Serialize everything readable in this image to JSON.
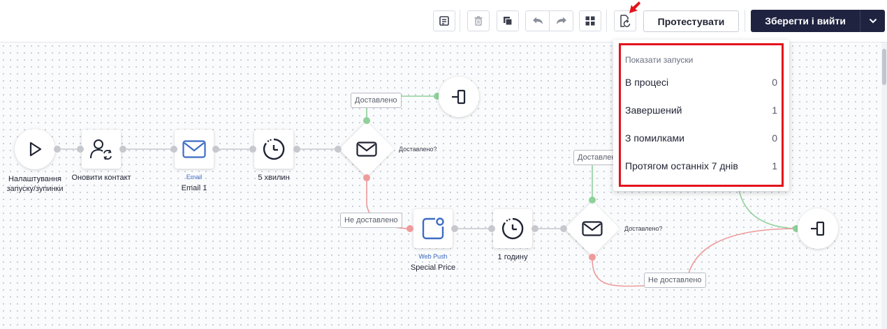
{
  "toolbar": {
    "icons": [
      "note-icon",
      "trash-icon",
      "duplicate-icon",
      "undo-icon",
      "redo-icon",
      "layout-grid-icon",
      "runs-history-icon"
    ],
    "test_label": "Протестувати",
    "save_label": "Зберегти і вийти"
  },
  "colors": {
    "accent_dark": "#1f2340",
    "email_blue": "#3e6bc4",
    "success_green": "#8fd19a",
    "fail_red": "#ee9b9b",
    "highlight_red": "#e3121a"
  },
  "nodes": {
    "start": {
      "label": "Налаштування\nзапуску/зупинки"
    },
    "update_contact": {
      "label": "Оновити контакт"
    },
    "email": {
      "type": "Email",
      "label": "Email 1"
    },
    "wait1": {
      "label": "5 хвилин"
    },
    "check1": {
      "question": "Доставлено?"
    },
    "webpush": {
      "type": "Web Push",
      "label": "Special Price"
    },
    "wait2": {
      "label": "1 годину"
    },
    "check2": {
      "question": "Доставлено?"
    }
  },
  "edge_labels": {
    "delivered_1": "Доставлено",
    "not_delivered_1": "Не доставлено",
    "delivered_2": "Доставлено",
    "not_delivered_2": "Не доставлено"
  },
  "popup": {
    "title": "Показати запуски",
    "rows": [
      {
        "label": "В процесі",
        "count": "0"
      },
      {
        "label": "Завершений",
        "count": "1"
      },
      {
        "label": "З помилками",
        "count": "0"
      },
      {
        "label": "Протягом останніх 7 днів",
        "count": "1"
      }
    ]
  }
}
